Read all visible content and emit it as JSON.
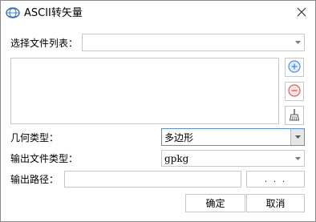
{
  "window": {
    "title": "ASCII转矢量",
    "close_icon": "close-icon",
    "logo_icon": "app-logo-icon"
  },
  "file_list": {
    "label": "选择文件列表：",
    "selected": "",
    "add_icon": "plus-circle-icon",
    "remove_icon": "minus-circle-icon",
    "clear_icon": "broom-icon",
    "add_color": "#4a8ee6",
    "remove_color": "#e05a5a"
  },
  "geometry_type": {
    "label": "几何类型：",
    "selected": "多边形"
  },
  "output_file_type": {
    "label": "输出文件类型：",
    "selected": "gpkg"
  },
  "output_path": {
    "label": "输出路径：",
    "value": "",
    "browse_label": ". . ."
  },
  "footer": {
    "ok_label": "确定",
    "cancel_label": "取消"
  }
}
